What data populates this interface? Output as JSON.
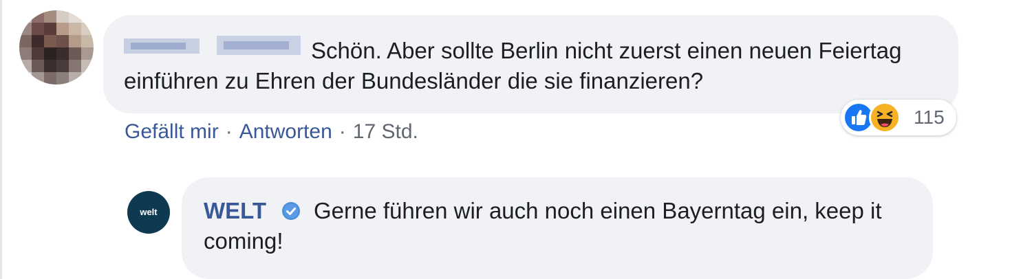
{
  "comment": {
    "author_redacted": true,
    "text": "Schön. Aber sollte Berlin nicht zuerst einen neuen Feiertag einführen zu Ehren der Bundesländer die sie finanzieren?",
    "actions": {
      "like_label": "Gefällt mir",
      "separator": "·",
      "reply_label": "Antworten",
      "timestamp": "17 Std."
    },
    "reactions": {
      "icons": [
        "like-icon",
        "haha-icon"
      ],
      "count": "115"
    }
  },
  "reply": {
    "avatar_text": "welt",
    "author": "WELT",
    "verified": true,
    "text": "Gerne führen wir auch noch einen Bayerntag ein, keep it coming!"
  },
  "colors": {
    "bubble": "#f0f2f5",
    "link": "#385898",
    "meta": "#606770",
    "like_blue": "#1877f2",
    "haha_yellow": "#f7b125",
    "welt_avatar": "#0e3a51"
  }
}
